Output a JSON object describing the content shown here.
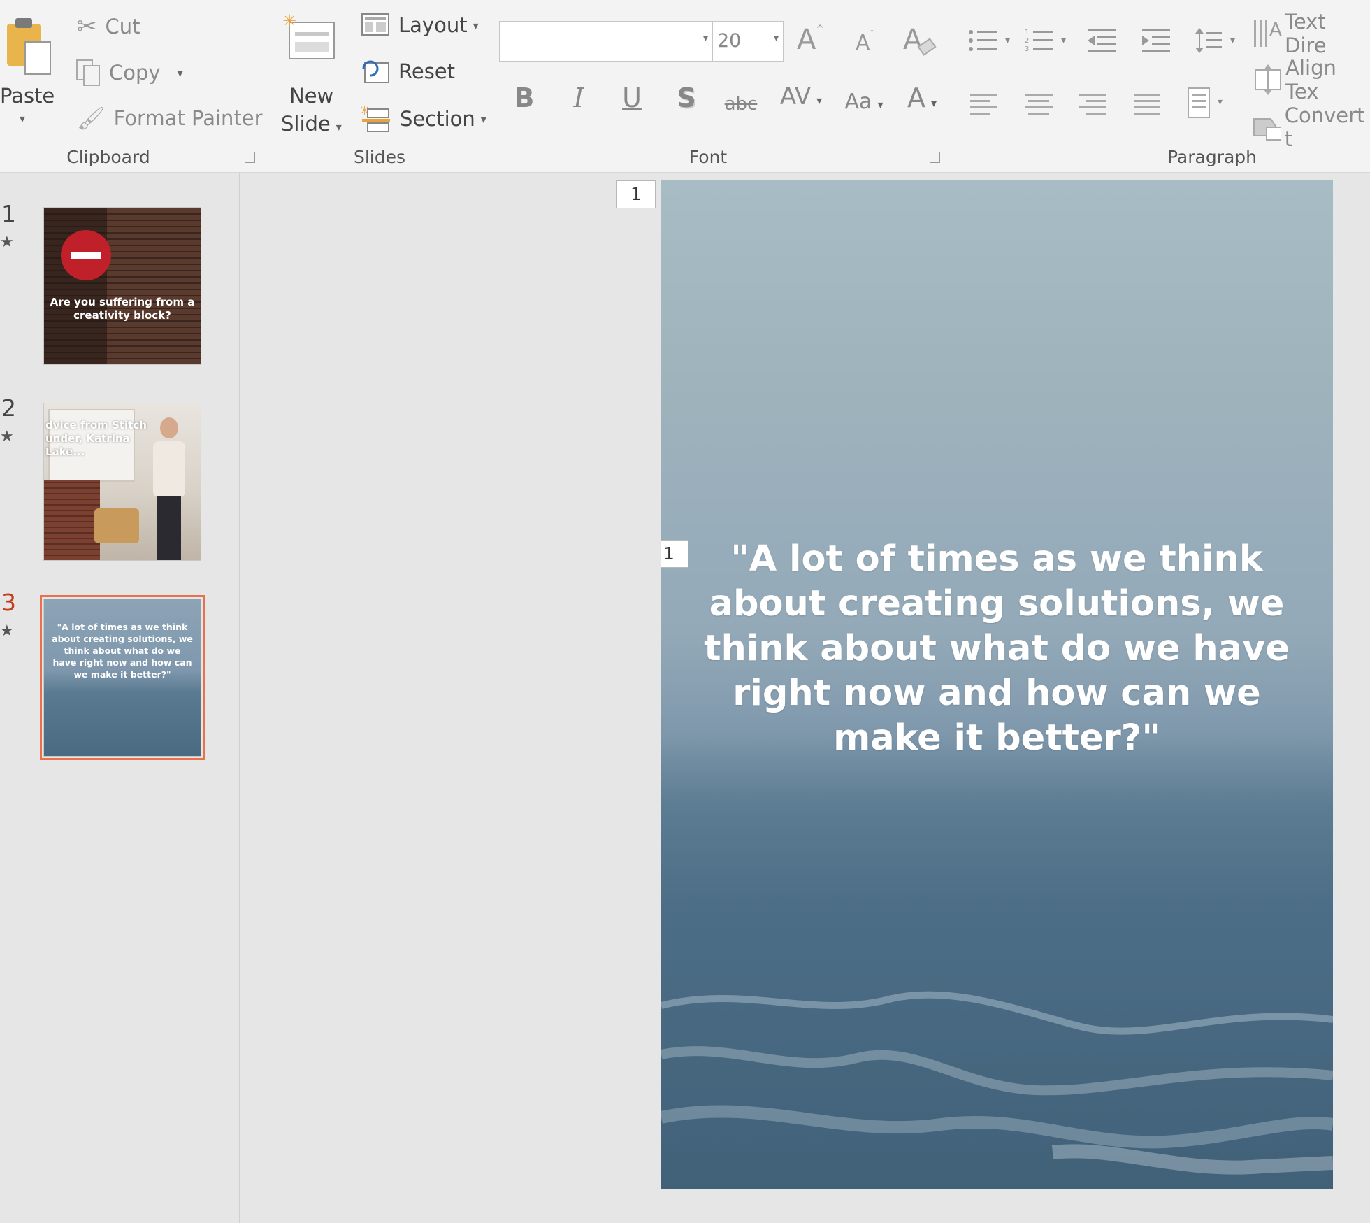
{
  "ribbon": {
    "clipboard": {
      "paste": "Paste",
      "cut": "Cut",
      "copy": "Copy",
      "format_painter": "Format Painter",
      "label": "Clipboard"
    },
    "slides": {
      "new_slide_line1": "New",
      "new_slide_line2": "Slide",
      "layout": "Layout",
      "reset": "Reset",
      "section": "Section",
      "label": "Slides"
    },
    "font": {
      "font_name": "",
      "font_size": "20",
      "grow": "A",
      "shrink": "A",
      "bold": "B",
      "italic": "I",
      "underline": "U",
      "shadow": "S",
      "strike": "abc",
      "spacing": "AV",
      "change_case": "Aa",
      "font_color": "A",
      "label": "Font"
    },
    "paragraph": {
      "text_direction": "Text Dire",
      "align_text": "Align Tex",
      "convert": "Convert t",
      "label": "Paragraph"
    }
  },
  "thumbnails": [
    {
      "number": "1",
      "text": "Are you suffering from a creativity block?"
    },
    {
      "number": "2",
      "text": "dvice from Stitch under, Katrina Lake..."
    },
    {
      "number": "3",
      "text": "\"A lot of times as we think about creating solutions, we think about what do we have right now and how can we make it better?\""
    }
  ],
  "slide": {
    "tag_top": "1",
    "tag_quote": "1",
    "quote": "\"A lot of times as we think about creating solutions, we think about what do we have right now and how can we make it better?\""
  },
  "colors": {
    "accent": "#c43e1c",
    "selection": "#e8704a"
  }
}
